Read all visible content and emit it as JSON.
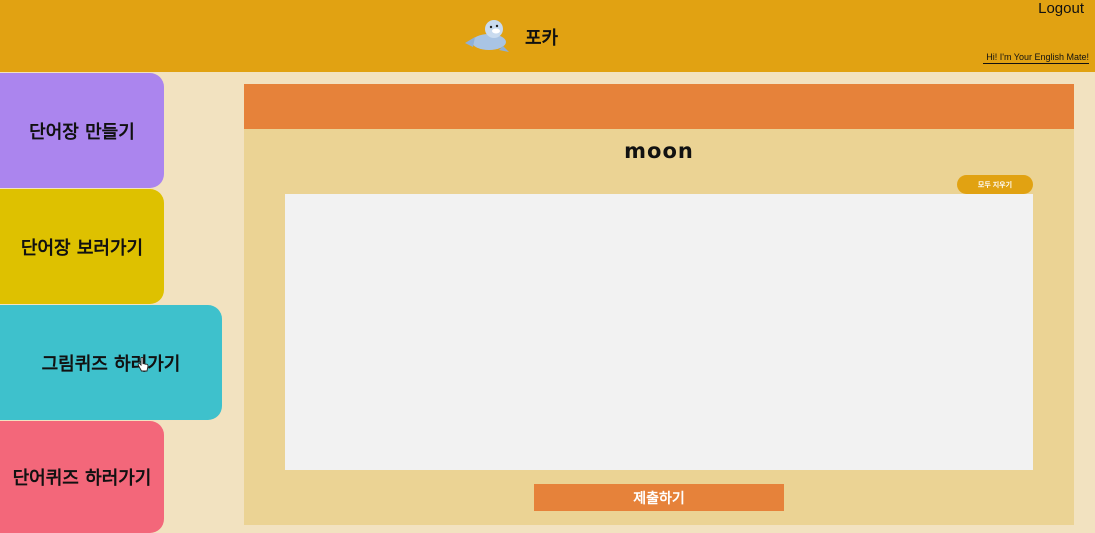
{
  "header": {
    "app_title": "포카",
    "logout_label": "Logout",
    "greeting": "Hi! I'm Your English Mate!",
    "logo_icon": "seal-mascot-icon"
  },
  "sidebar": {
    "items": [
      {
        "label": "단어장 만들기",
        "color": "#ab85ee"
      },
      {
        "label": "단어장 보러가기",
        "color": "#dec100"
      },
      {
        "label": "그림퀴즈 하러가기",
        "color": "#3ec1cc",
        "active": true
      },
      {
        "label": "단어퀴즈 하러가기",
        "color": "#f3677a"
      }
    ]
  },
  "quiz": {
    "word": "moon",
    "clear_label": "모두 지우기",
    "submit_label": "제출하기"
  },
  "colors": {
    "header": "#e1a212",
    "background": "#f2e2c0",
    "panel": "#ebd394",
    "accent": "#e6823a",
    "canvas": "#f2f2f2"
  }
}
